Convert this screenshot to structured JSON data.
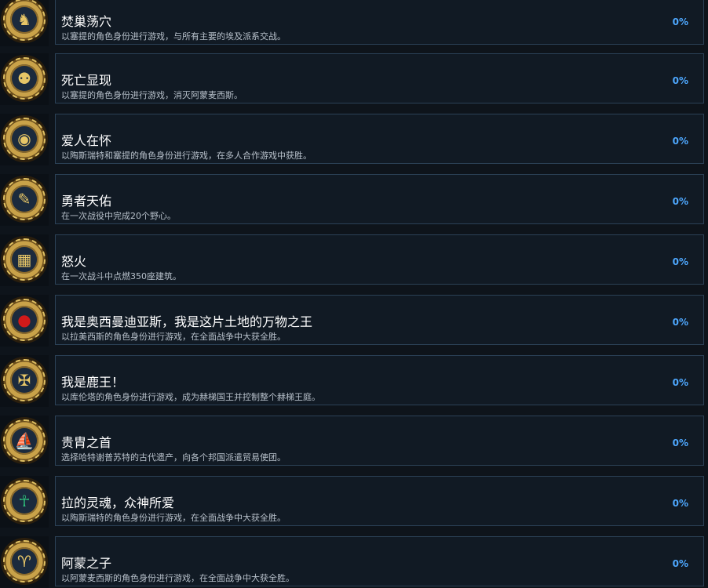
{
  "achievements": [
    {
      "title": "焚巢荡穴",
      "description": "以塞提的角色身份进行游戏，与所有主要的埃及派系交战。",
      "percent": "0%",
      "icon": "jackal-icon",
      "glyph": "♞",
      "accent": "#e7c667"
    },
    {
      "title": "死亡显现",
      "description": "以塞提的角色身份进行游戏，消灭阿蒙麦西斯。",
      "percent": "0%",
      "icon": "winged-scarab-icon",
      "glyph": "⚉",
      "accent": "#e7c667"
    },
    {
      "title": "爱人在怀",
      "description": "以陶斯瑞特和塞提的角色身份进行游戏，在多人合作游戏中获胜。",
      "percent": "0%",
      "icon": "eye-of-horus-icon",
      "glyph": "◉",
      "accent": "#e7c667"
    },
    {
      "title": "勇者天佑",
      "description": "在一次战役中完成20个野心。",
      "percent": "0%",
      "icon": "scroll-icon",
      "glyph": "✎",
      "accent": "#e7c667"
    },
    {
      "title": "怒火",
      "description": "在一次战斗中点燃350座建筑。",
      "percent": "0%",
      "icon": "burning-building-icon",
      "glyph": "▦",
      "accent": "#e7c667"
    },
    {
      "title": "我是奥西曼迪亚斯，我是这片土地的万物之王",
      "description": "以拉美西斯的角色身份进行游戏，在全面战争中大获全胜。",
      "percent": "0%",
      "icon": "sun-disk-icon",
      "glyph": "●",
      "accent": "#d11a1a"
    },
    {
      "title": "我是鹿王！",
      "description": "以库伦塔的角色身份进行游戏，成为赫梯国王并控制整个赫梯王庭。",
      "percent": "0%",
      "icon": "eagle-icon",
      "glyph": "✠",
      "accent": "#e7c667"
    },
    {
      "title": "贵胄之首",
      "description": "选择哈特谢普苏特的古代遗产，向各个邦国派遣贸易使团。",
      "percent": "0%",
      "icon": "ship-icon",
      "glyph": "⛵",
      "accent": "#e7c667"
    },
    {
      "title": "拉的灵魂，众神所爱",
      "description": "以陶斯瑞特的角色身份进行游戏，在全面战争中大获全胜。",
      "percent": "0%",
      "icon": "ankh-icon",
      "glyph": "☥",
      "accent": "#2fbf7a"
    },
    {
      "title": "阿蒙之子",
      "description": "以阿蒙麦西斯的角色身份进行游戏，在全面战争中大获全胜。",
      "percent": "0%",
      "icon": "ram-head-icon",
      "glyph": "♈",
      "accent": "#e7c667"
    }
  ]
}
